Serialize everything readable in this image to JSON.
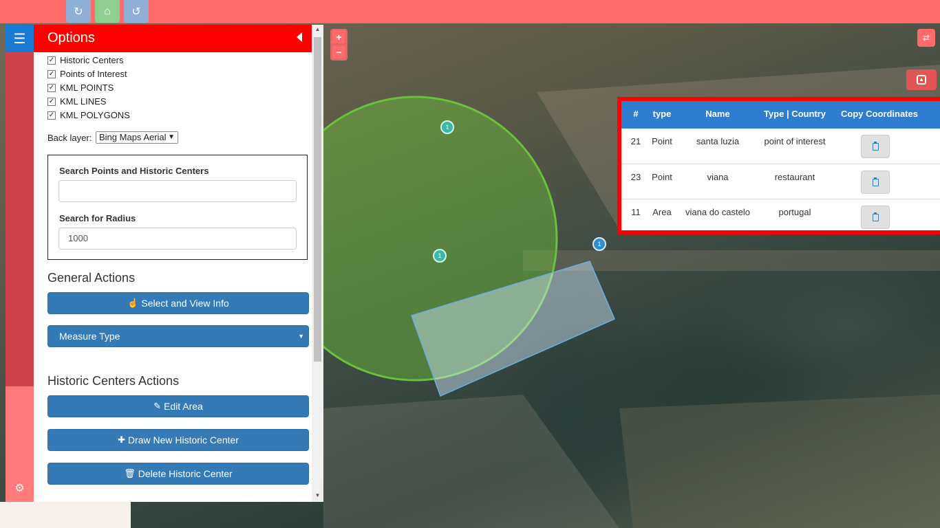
{
  "toolbar": {
    "refresh_icon": "refresh-icon",
    "home_icon": "home-icon",
    "undo_icon": "undo-icon"
  },
  "panel": {
    "title": "Options",
    "layers": [
      {
        "label": "Historic Centers",
        "checked": true
      },
      {
        "label": "Points of Interest",
        "checked": true
      },
      {
        "label": "KML POINTS",
        "checked": true
      },
      {
        "label": "KML LINES",
        "checked": true
      },
      {
        "label": "KML POLYGONS",
        "checked": true
      }
    ],
    "back_layer_label": "Back layer:",
    "back_layer_value": "Bing Maps Aerial",
    "search_points_label": "Search Points and Historic Centers",
    "search_points_value": "",
    "search_radius_label": "Search for Radius",
    "search_radius_value": "1000",
    "general_actions_title": "General Actions",
    "select_view_info": "Select and View Info",
    "measure_type": "Measure Type",
    "historic_actions_title": "Historic Centers Actions",
    "edit_area": "Edit Area",
    "draw_new": "Draw New Historic Center",
    "delete_center": "Delete Historic Center"
  },
  "map": {
    "zoom_in": "+",
    "zoom_out": "−",
    "cluster_label": "1",
    "circle_color": "#6ac23a",
    "polygon_color": "#6aaede"
  },
  "results": {
    "headers": [
      "#",
      "type",
      "Name",
      "Type | Country",
      "Copy Coordinates"
    ],
    "rows": [
      {
        "id": "21",
        "type": "Point",
        "name": "santa luzia",
        "type_country": "point of interest"
      },
      {
        "id": "23",
        "type": "Point",
        "name": "viana",
        "type_country": "restaurant"
      },
      {
        "id": "11",
        "type": "Area",
        "name": "viana do castelo",
        "type_country": "portugal"
      }
    ]
  },
  "colors": {
    "topbar": "#ff6b6b",
    "panel_header": "#ff0000",
    "primary_button": "#337ab7",
    "table_header": "#2e7dd1"
  }
}
